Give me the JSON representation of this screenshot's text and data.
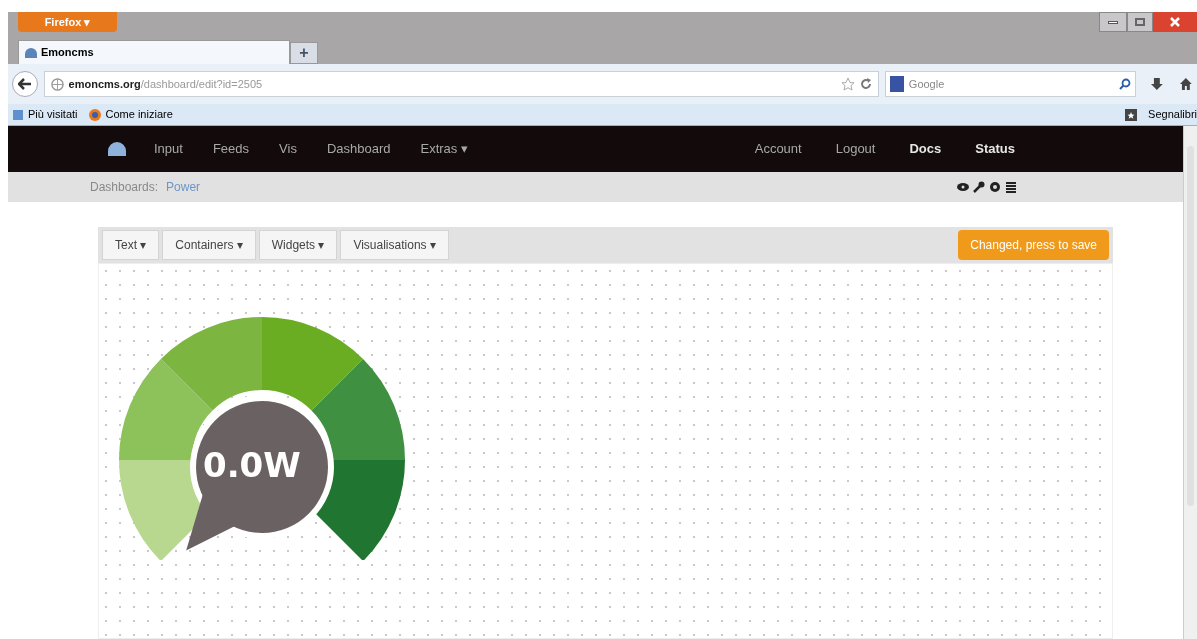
{
  "browser": {
    "menu_button": "Firefox ▾",
    "tabs": [
      {
        "label": "Emoncms",
        "selected": true
      }
    ],
    "new_tab": "+",
    "url_host": "emoncms.org",
    "url_path": "/dashboard/edit?id=2505",
    "search_engine": "Google",
    "bookmarks": [
      "Più visitati",
      "Come iniziare"
    ],
    "bookmarks_menu": "Segnalibri"
  },
  "navbar": {
    "left": [
      {
        "label": "Input",
        "bold": false
      },
      {
        "label": "Feeds",
        "bold": false
      },
      {
        "label": "Vis",
        "bold": false
      },
      {
        "label": "Dashboard",
        "bold": false
      },
      {
        "label": "Extras ▾",
        "bold": false
      }
    ],
    "right": [
      {
        "label": "Account",
        "bold": false
      },
      {
        "label": "Logout",
        "bold": false
      },
      {
        "label": "Docs",
        "bold": true
      },
      {
        "label": "Status",
        "bold": true
      }
    ]
  },
  "subbar": {
    "label": "Dashboards:",
    "link": "Power"
  },
  "toolbar": {
    "menus": [
      "Text ▾",
      "Containers ▾",
      "Widgets ▾",
      "Visualisations ▾"
    ],
    "save_button": "Changed, press to save"
  },
  "gauge": {
    "reading": "0.0W"
  }
}
